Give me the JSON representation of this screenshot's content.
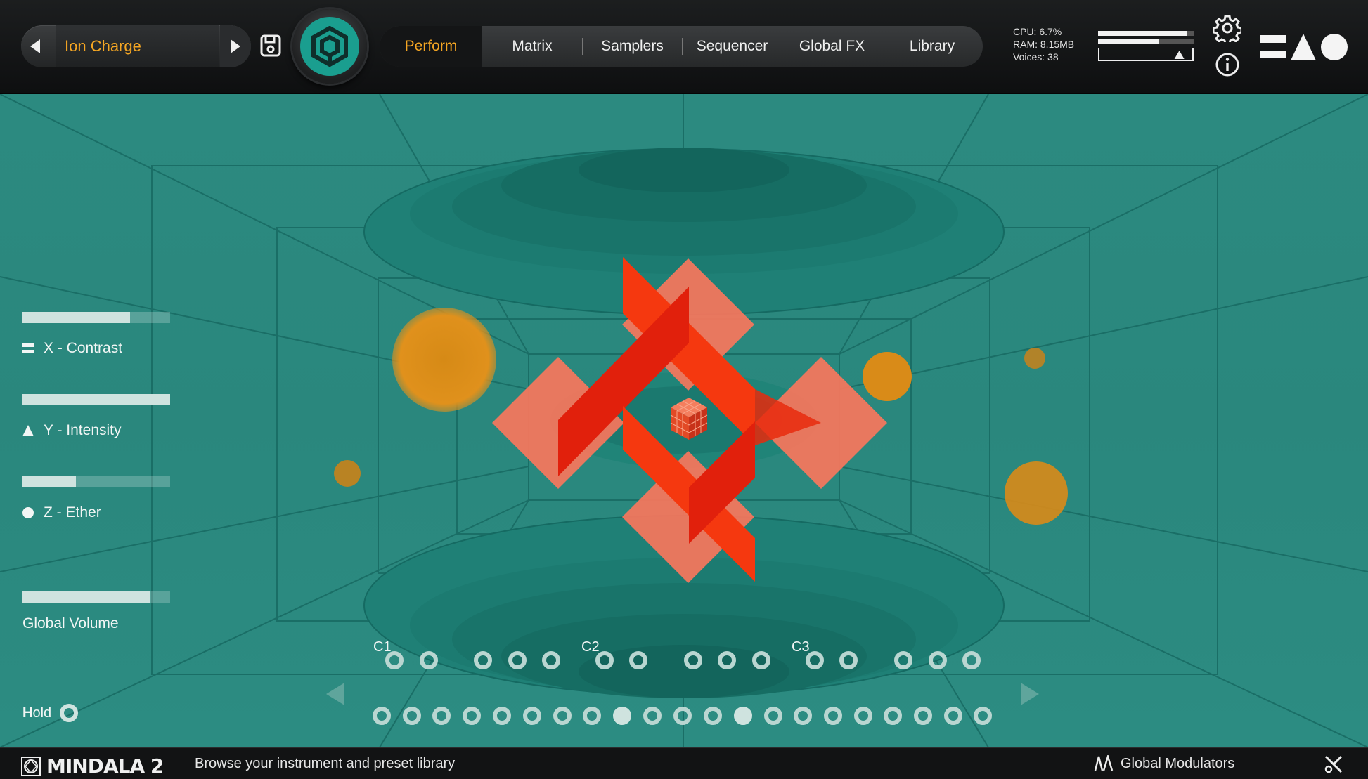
{
  "header": {
    "preset_name": "Ion Charge",
    "tabs": [
      {
        "label": "Perform",
        "active": true
      },
      {
        "label": "Matrix",
        "active": false
      },
      {
        "label": "Samplers",
        "active": false
      },
      {
        "label": "Sequencer",
        "active": false
      },
      {
        "label": "Global FX",
        "active": false
      },
      {
        "label": "Library",
        "active": false
      }
    ],
    "stats": {
      "cpu": "CPU: 6.7%",
      "ram": "RAM: 8.15MB",
      "voices": "Voices: 38"
    },
    "meter": {
      "level_top": 0.93,
      "level_bottom": 0.64,
      "marker": 0.85
    },
    "icons": [
      "prev-arrow-icon",
      "next-arrow-icon",
      "save-icon",
      "mindala-logo-icon",
      "settings-gear-icon",
      "info-icon",
      "brand-shapes-icon"
    ]
  },
  "params": [
    {
      "label": "X - Contrast",
      "value": 0.73,
      "icon": "equals-icon"
    },
    {
      "label": "Y - Intensity",
      "value": 1.0,
      "icon": "triangle-icon"
    },
    {
      "label": "Z - Ether",
      "value": 0.36,
      "icon": "circle-icon"
    },
    {
      "label": "Global Volume",
      "value": 0.86,
      "icon": ""
    }
  ],
  "hold": {
    "label_bold": "H",
    "label_rest": "old"
  },
  "keyboard": {
    "octave_labels": [
      "C1",
      "C2",
      "C3"
    ],
    "top_row_active": [],
    "bottom_row_active": [
      8,
      12
    ]
  },
  "footer": {
    "title": "MINDALA 2",
    "hint": "Browse your instrument and preset library",
    "modulators": "Global Modulators"
  },
  "colors": {
    "accent": "#f5a623",
    "stage": "#2a8a80",
    "shape_red": "#ee2a0a",
    "shape_salmon": "#f86a50",
    "orb": "#e08a1a"
  }
}
